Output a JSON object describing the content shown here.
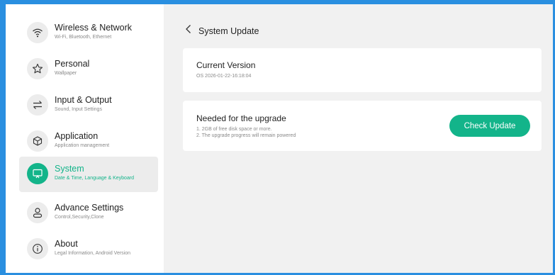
{
  "sidebar": {
    "items": [
      {
        "title": "Wireless & Network",
        "subtitle": "Wi-Fi, Bluetooth, Ethernet",
        "icon": "wifi-icon"
      },
      {
        "title": "Personal",
        "subtitle": "Wallpaper",
        "icon": "star-icon"
      },
      {
        "title": "Input & Output",
        "subtitle": "Sound, Input Settings",
        "icon": "swap-arrows-icon"
      },
      {
        "title": "Application",
        "subtitle": "Application management",
        "icon": "cube-icon"
      },
      {
        "title": "System",
        "subtitle": "Date & Time, Language & Keyboard",
        "icon": "monitor-icon",
        "active": true
      },
      {
        "title": "Advance Settings",
        "subtitle": "Control,Security,Clone",
        "icon": "user-icon"
      },
      {
        "title": "About",
        "subtitle": "Legal Information, Android Version",
        "icon": "info-icon"
      }
    ]
  },
  "header": {
    "back_icon": "chevron-left-icon",
    "title": "System Update"
  },
  "current_version": {
    "title": "Current Version",
    "value": "OS 2026-01-22-16:18:04"
  },
  "upgrade": {
    "title": "Needed for the upgrade",
    "lines": [
      "1. 2GB of free disk space or more.",
      "2. The upgrade progress will remain powered"
    ],
    "button_label": "Check Update"
  },
  "colors": {
    "accent": "#13b48a",
    "frame": "#2a8fe0",
    "background": "#f1f1f1"
  }
}
